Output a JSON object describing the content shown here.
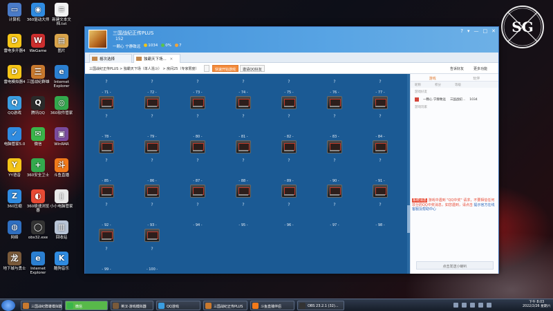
{
  "desktop": {
    "icons": [
      {
        "label": "计算机",
        "color": "#4a7bc8",
        "glyph": "▭"
      },
      {
        "label": "360驱动大师",
        "color": "#2f8be0",
        "glyph": "◉"
      },
      {
        "label": "新建文本文档.txt",
        "color": "#f2f2f2",
        "glyph": "≡"
      },
      {
        "label": "雷电多开器4",
        "color": "#f5c518",
        "glyph": "D"
      },
      {
        "label": "WeGame",
        "color": "#cc2e2e",
        "glyph": "W"
      },
      {
        "label": "图片",
        "color": "#d9a44b",
        "glyph": "▤"
      },
      {
        "label": "雷电模拟器4",
        "color": "#f5c518",
        "glyph": "D"
      },
      {
        "label": "三国战纪群雄",
        "color": "#c9792e",
        "glyph": "三"
      },
      {
        "label": "Internet Explorer",
        "color": "#2b7fd1",
        "glyph": "e"
      },
      {
        "label": "QQ游戏",
        "color": "#3a9de0",
        "glyph": "Q"
      },
      {
        "label": "腾讯QQ",
        "color": "#2a2a2a",
        "glyph": "Q"
      },
      {
        "label": "360软件管家",
        "color": "#33a94d",
        "glyph": "◎"
      },
      {
        "label": "电脑管家5.0",
        "color": "#2f8be0",
        "glyph": "✓"
      },
      {
        "label": "微信",
        "color": "#3ab54a",
        "glyph": "✉"
      },
      {
        "label": "WinRAR",
        "color": "#7a4b9e",
        "glyph": "▣"
      },
      {
        "label": "YY语音",
        "color": "#f5c518",
        "glyph": "Y"
      },
      {
        "label": "360安全卫士",
        "color": "#33a94d",
        "glyph": "+"
      },
      {
        "label": "斗鱼直播",
        "color": "#f27a1a",
        "glyph": "斗"
      },
      {
        "label": "360压缩",
        "color": "#2f8be0",
        "glyph": "Z"
      },
      {
        "label": "360极速浏览器",
        "color": "#e84a34",
        "glyph": "◐"
      },
      {
        "label": "小小电脑管家",
        "color": "#e8e8e8",
        "glyph": "▯"
      },
      {
        "label": "网络",
        "color": "#2f6fc1",
        "glyph": "◍"
      },
      {
        "label": "obs32.exe",
        "color": "#333333",
        "glyph": "◯"
      },
      {
        "label": "回收站",
        "color": "#b8c4d6",
        "glyph": "▥"
      },
      {
        "label": "地下城与勇士",
        "color": "#7a5a3a",
        "glyph": "龙"
      },
      {
        "label": "Internet Explorer",
        "color": "#2b7fd1",
        "glyph": "e"
      },
      {
        "label": "酷狗音乐",
        "color": "#2f8be0",
        "glyph": "K"
      }
    ],
    "logo_text": "SG"
  },
  "window": {
    "title": "三国战纪正传PLUS",
    "subtitle": "152",
    "stats": [
      {
        "text": "一颗心 宁静致远",
        "color": "#ffffff"
      },
      {
        "text": "1034",
        "color": "#f0c419"
      },
      {
        "text": "0%",
        "color": "#59c44a"
      },
      {
        "text": "7",
        "color": "#f0a43a"
      }
    ],
    "controls": [
      "?",
      "▾",
      "—",
      "□",
      "✕"
    ],
    "tabs": [
      {
        "label": "格次选择"
      },
      {
        "label": "独霸天下场...",
        "close": "✕"
      }
    ],
    "breadcrumb": "三国战纪正传PLUS > 独霸天下场（单人混斗） > 房间25（专家限度）",
    "toolbar": {
      "quick_start": "快速开始游戏",
      "invite": "邀请QQ好友",
      "help": "告诉好友",
      "more": "更多功能"
    }
  },
  "rooms": {
    "top_row_q": "?",
    "labels": [
      "- 71 -",
      "- 72 -",
      "- 73 -",
      "- 74 -",
      "- 75 -",
      "- 76 -",
      "- 77 -",
      "- 78 -",
      "- 79 -",
      "- 80 -",
      "- 81 -",
      "- 82 -",
      "- 83 -",
      "- 84 -",
      "- 85 -",
      "- 86 -",
      "- 87 -",
      "- 88 -",
      "- 89 -",
      "- 90 -",
      "- 91 -",
      "- 92 -",
      "- 93 -",
      "- 94 -",
      "- 95 -",
      "- 96 -",
      "- 97 -",
      "- 98 -",
      "- 99 -",
      "- 100 -"
    ],
    "occupied_count_row4": 2
  },
  "panel": {
    "tabs": [
      "游戏",
      "玩伴"
    ],
    "columns": [
      "昵称",
      "积分",
      "等级"
    ],
    "section1": "游戏好友",
    "friend": {
      "name": "一颗心 宁静致远",
      "game": "三国战纪...",
      "score": "1034"
    },
    "section2": "游戏玩家",
    "chat_tag": "系统消息",
    "chat_line1": "游戏中遇到 \"QQ中奖\" 请求，不要相信任何非分的QQ中奖消息，如您遇到，请点击",
    "chat_link": "提示官方在线客服及帮助中心",
    "input_placeholder": "点击发送小喇叭"
  },
  "taskbar": {
    "apps": [
      {
        "label": "三国战纪群雄模拟器",
        "color": "#c9792e"
      },
      {
        "label": "微信",
        "color": "#3ab54a"
      },
      {
        "label": "英汉-游戏模拟器",
        "color": "#7a5a3a"
      },
      {
        "label": "QQ游戏",
        "color": "#3a9de0"
      },
      {
        "label": "三国战纪正传PLUS",
        "color": "#c9792e"
      },
      {
        "label": "斗鱼直播伴侣",
        "color": "#f27a1a"
      },
      {
        "label": "OBS 23.2.1 (32)...",
        "color": "#333333"
      }
    ],
    "time": "下午 8:03",
    "date": "2022/2/26 星期六"
  }
}
